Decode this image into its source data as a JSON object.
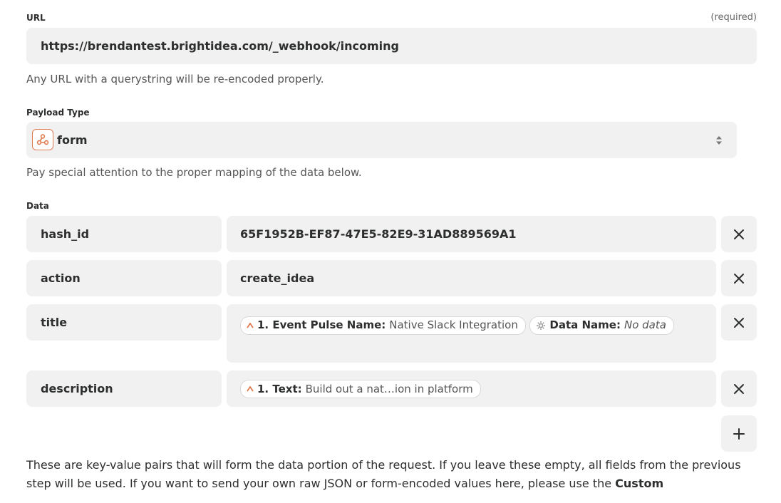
{
  "url_field": {
    "label": "URL",
    "required": "(required)",
    "value": "https://brendantest.brightidea.com/_webhook/incoming",
    "help": "Any URL with a querystring will be re-encoded properly."
  },
  "payload_type": {
    "label": "Payload Type",
    "value": "form",
    "help": "Pay special attention to the proper mapping of the data below."
  },
  "data": {
    "label": "Data",
    "rows": [
      {
        "key": "hash_id",
        "value": "65F1952B-EF87-47E5-82E9-31AD889569A1"
      },
      {
        "key": "action",
        "value": "create_idea"
      },
      {
        "key": "title",
        "pills": [
          {
            "label": "1. Event Pulse Name:",
            "value": "Native Slack Integration"
          },
          {
            "label": "Data Name:",
            "value_italic": "No data"
          }
        ]
      },
      {
        "key": "description",
        "pills": [
          {
            "label": "1. Text:",
            "value": "Build out a nat…ion in platform"
          }
        ]
      }
    ],
    "remove_icon": "close-icon",
    "add_icon": "plus-icon"
  },
  "footer": {
    "text": "These are key-value pairs that will form the data portion of the request. If you leave these empty, all fields from the previous step will be used. If you want to send your own raw JSON or form-encoded values here, please use the",
    "bold": "Custom"
  },
  "colors": {
    "field_bg": "#f1f1f1",
    "accent": "#e07b4f"
  }
}
